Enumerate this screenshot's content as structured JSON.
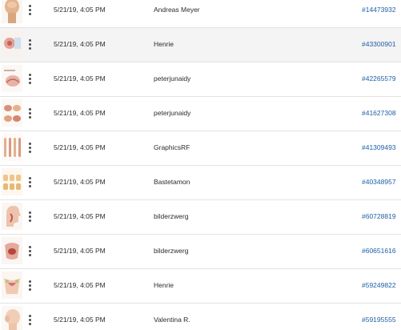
{
  "rows": [
    {
      "thumb": "bald-head-thumbnail",
      "date": "5/21/19, 4:05 PM",
      "author": "Andreas Meyer",
      "id": "#14473932"
    },
    {
      "thumb": "eye-anatomy-thumbnail",
      "date": "5/21/19, 4:05 PM",
      "author": "Henrie",
      "id": "#43300901"
    },
    {
      "thumb": "anatomy-diagram-thumbnail",
      "date": "5/21/19, 4:05 PM",
      "author": "peterjunaidy",
      "id": "#42265579"
    },
    {
      "thumb": "organ-illustrations-thumbnail",
      "date": "5/21/19, 4:05 PM",
      "author": "peterjunaidy",
      "id": "#41627308"
    },
    {
      "thumb": "body-figures-thumbnail",
      "date": "5/21/19, 4:05 PM",
      "author": "GraphicsRF",
      "id": "#41309493"
    },
    {
      "thumb": "torso-grid-thumbnail",
      "date": "5/21/19, 4:05 PM",
      "author": "Bastetamon",
      "id": "#40348957"
    },
    {
      "thumb": "head-cross-section-thumbnail",
      "date": "5/21/19, 4:05 PM",
      "author": "bilderzwerg",
      "id": "#60728819"
    },
    {
      "thumb": "pelvic-anatomy-thumbnail",
      "date": "5/21/19, 4:05 PM",
      "author": "bilderzwerg",
      "id": "#60651616"
    },
    {
      "thumb": "uterus-anatomy-thumbnail",
      "date": "5/21/19, 4:05 PM",
      "author": "Henrie",
      "id": "#59249822"
    },
    {
      "thumb": "head-profile-thumbnail",
      "date": "5/21/19, 4:05 PM",
      "author": "Valentina R.",
      "id": "#59195555"
    }
  ],
  "more_icon": "more-vertical-icon",
  "colors": {
    "link": "#1f5fa6",
    "hover_row": "#f4f4f4",
    "divider": "#e3e3e3"
  }
}
